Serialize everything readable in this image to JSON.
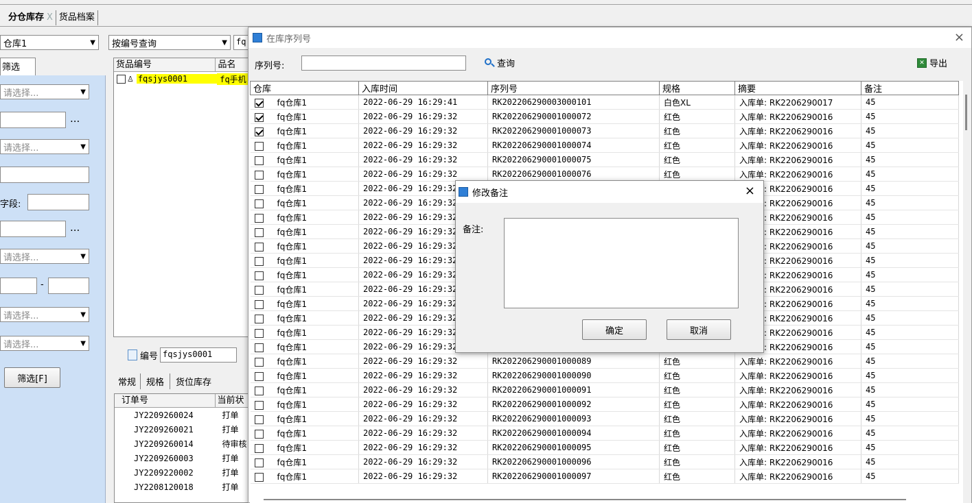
{
  "tabs": [
    {
      "label": "分仓库存",
      "close": "X",
      "active": true
    },
    {
      "label": "货品档案",
      "active": false
    }
  ],
  "filter": {
    "warehouse": "仓库1",
    "tab_label": "筛选",
    "placeholder_select": "请选择...",
    "ellipsis": "...",
    "field_label": "字段:",
    "range_dash": "-",
    "filter_button": "筛选[F]"
  },
  "goods": {
    "query_mode": "按编号查询",
    "query_prefix": "fq",
    "columns": [
      "货品编号",
      "品名"
    ],
    "row": {
      "code": "fqsjys0001",
      "name": "fq手机"
    },
    "code_label": "编号",
    "code_value": "fqsjys0001",
    "detail_tabs": [
      "常规",
      "规格",
      "货位库存"
    ],
    "order_columns": [
      "订单号",
      "当前状"
    ],
    "orders": [
      {
        "no": "JY2209260024",
        "status": "打单"
      },
      {
        "no": "JY2209260021",
        "status": "打单"
      },
      {
        "no": "JY2209260014",
        "status": "待审核"
      },
      {
        "no": "JY2209260003",
        "status": "打单"
      },
      {
        "no": "JY2209220002",
        "status": "打单"
      },
      {
        "no": "JY2208120018",
        "status": "打单"
      }
    ]
  },
  "serial_dialog": {
    "title": "在库序列号",
    "serial_label": "序列号:",
    "query_button": "查询",
    "export_button": "导出",
    "columns": [
      "仓库",
      "入库时间",
      "序列号",
      "规格",
      "摘要",
      "备注"
    ],
    "rows": [
      {
        "checked": true,
        "wh": "fq仓库1",
        "time": "2022-06-29 16:29:41",
        "sn": "RK202206290003000101",
        "spec": "白色XL",
        "summary": "入库单: RK2206290017",
        "remark": "45"
      },
      {
        "checked": true,
        "wh": "fq仓库1",
        "time": "2022-06-29 16:29:32",
        "sn": "RK202206290001000072",
        "spec": "红色",
        "summary": "入库单: RK2206290016",
        "remark": "45"
      },
      {
        "checked": true,
        "wh": "fq仓库1",
        "time": "2022-06-29 16:29:32",
        "sn": "RK202206290001000073",
        "spec": "红色",
        "summary": "入库单: RK2206290016",
        "remark": "45"
      },
      {
        "checked": false,
        "wh": "fq仓库1",
        "time": "2022-06-29 16:29:32",
        "sn": "RK202206290001000074",
        "spec": "红色",
        "summary": "入库单: RK2206290016",
        "remark": "45"
      },
      {
        "checked": false,
        "wh": "fq仓库1",
        "time": "2022-06-29 16:29:32",
        "sn": "RK202206290001000075",
        "spec": "红色",
        "summary": "入库单: RK2206290016",
        "remark": "45"
      },
      {
        "checked": false,
        "wh": "fq仓库1",
        "time": "2022-06-29 16:29:32",
        "sn": "RK202206290001000076",
        "spec": "红色",
        "summary": "入库单: RK2206290016",
        "remark": "45"
      },
      {
        "checked": false,
        "wh": "fq仓库1",
        "time": "2022-06-29 16:29:32",
        "sn": "",
        "spec": "",
        "summary": "入库单: RK2206290016",
        "remark": "45"
      },
      {
        "checked": false,
        "wh": "fq仓库1",
        "time": "2022-06-29 16:29:32",
        "sn": "",
        "spec": "",
        "summary": "入库单: RK2206290016",
        "remark": "45"
      },
      {
        "checked": false,
        "wh": "fq仓库1",
        "time": "2022-06-29 16:29:32",
        "sn": "",
        "spec": "",
        "summary": "入库单: RK2206290016",
        "remark": "45"
      },
      {
        "checked": false,
        "wh": "fq仓库1",
        "time": "2022-06-29 16:29:32",
        "sn": "",
        "spec": "",
        "summary": "入库单: RK2206290016",
        "remark": "45"
      },
      {
        "checked": false,
        "wh": "fq仓库1",
        "time": "2022-06-29 16:29:32",
        "sn": "",
        "spec": "",
        "summary": "入库单: RK2206290016",
        "remark": "45"
      },
      {
        "checked": false,
        "wh": "fq仓库1",
        "time": "2022-06-29 16:29:32",
        "sn": "",
        "spec": "",
        "summary": "入库单: RK2206290016",
        "remark": "45"
      },
      {
        "checked": false,
        "wh": "fq仓库1",
        "time": "2022-06-29 16:29:32",
        "sn": "",
        "spec": "",
        "summary": "入库单: RK2206290016",
        "remark": "45"
      },
      {
        "checked": false,
        "wh": "fq仓库1",
        "time": "2022-06-29 16:29:32",
        "sn": "",
        "spec": "",
        "summary": "入库单: RK2206290016",
        "remark": "45"
      },
      {
        "checked": false,
        "wh": "fq仓库1",
        "time": "2022-06-29 16:29:32",
        "sn": "",
        "spec": "",
        "summary": "入库单: RK2206290016",
        "remark": "45"
      },
      {
        "checked": false,
        "wh": "fq仓库1",
        "time": "2022-06-29 16:29:32",
        "sn": "",
        "spec": "",
        "summary": "入库单: RK2206290016",
        "remark": "45"
      },
      {
        "checked": false,
        "wh": "fq仓库1",
        "time": "2022-06-29 16:29:32",
        "sn": "",
        "spec": "",
        "summary": "入库单: RK2206290016",
        "remark": "45"
      },
      {
        "checked": false,
        "wh": "fq仓库1",
        "time": "2022-06-29 16:29:32",
        "sn": "",
        "spec": "",
        "summary": "入库单: RK2206290016",
        "remark": "45"
      },
      {
        "checked": false,
        "wh": "fq仓库1",
        "time": "2022-06-29 16:29:32",
        "sn": "RK202206290001000089",
        "spec": "红色",
        "summary": "入库单: RK2206290016",
        "remark": "45"
      },
      {
        "checked": false,
        "wh": "fq仓库1",
        "time": "2022-06-29 16:29:32",
        "sn": "RK202206290001000090",
        "spec": "红色",
        "summary": "入库单: RK2206290016",
        "remark": "45"
      },
      {
        "checked": false,
        "wh": "fq仓库1",
        "time": "2022-06-29 16:29:32",
        "sn": "RK202206290001000091",
        "spec": "红色",
        "summary": "入库单: RK2206290016",
        "remark": "45"
      },
      {
        "checked": false,
        "wh": "fq仓库1",
        "time": "2022-06-29 16:29:32",
        "sn": "RK202206290001000092",
        "spec": "红色",
        "summary": "入库单: RK2206290016",
        "remark": "45"
      },
      {
        "checked": false,
        "wh": "fq仓库1",
        "time": "2022-06-29 16:29:32",
        "sn": "RK202206290001000093",
        "spec": "红色",
        "summary": "入库单: RK2206290016",
        "remark": "45"
      },
      {
        "checked": false,
        "wh": "fq仓库1",
        "time": "2022-06-29 16:29:32",
        "sn": "RK202206290001000094",
        "spec": "红色",
        "summary": "入库单: RK2206290016",
        "remark": "45"
      },
      {
        "checked": false,
        "wh": "fq仓库1",
        "time": "2022-06-29 16:29:32",
        "sn": "RK202206290001000095",
        "spec": "红色",
        "summary": "入库单: RK2206290016",
        "remark": "45"
      },
      {
        "checked": false,
        "wh": "fq仓库1",
        "time": "2022-06-29 16:29:32",
        "sn": "RK202206290001000096",
        "spec": "红色",
        "summary": "入库单: RK2206290016",
        "remark": "45"
      },
      {
        "checked": false,
        "wh": "fq仓库1",
        "time": "2022-06-29 16:29:32",
        "sn": "RK202206290001000097",
        "spec": "红色",
        "summary": "入库单: RK2206290016",
        "remark": "45"
      }
    ]
  },
  "remark_modal": {
    "title": "修改备注",
    "remark_label": "备注:",
    "remark_value": "",
    "ok_button": "确定",
    "cancel_button": "取消",
    "close": "×"
  },
  "icons": {
    "app": "app-window-icon",
    "search": "magnifier-icon",
    "export": "excel-export-icon",
    "code": "document-icon",
    "goods_row": "user-node-icon"
  },
  "colors": {
    "panel_blue": "#cde0f6",
    "selected_row": "#ffff00",
    "accent_blue": "#1e6fc8"
  }
}
